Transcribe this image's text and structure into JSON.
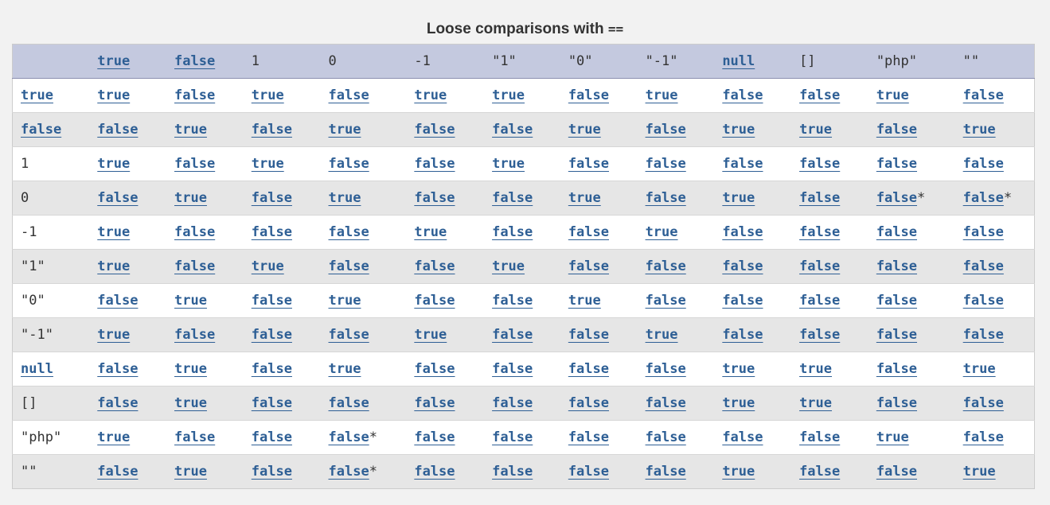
{
  "caption": {
    "text": "Loose comparisons with",
    "operator": "=="
  },
  "columns": [
    "",
    "true",
    "false",
    "1",
    "0",
    "-1",
    "\"1\"",
    "\"0\"",
    "\"-1\"",
    "null",
    "[]",
    "\"php\"",
    "\"\""
  ],
  "rows": [
    {
      "label": "true",
      "cells": [
        "true",
        "false",
        "true",
        "false",
        "true",
        "true",
        "false",
        "true",
        "false",
        "false",
        "true",
        "false"
      ]
    },
    {
      "label": "false",
      "cells": [
        "false",
        "true",
        "false",
        "true",
        "false",
        "false",
        "true",
        "false",
        "true",
        "true",
        "false",
        "true"
      ]
    },
    {
      "label": "1",
      "cells": [
        "true",
        "false",
        "true",
        "false",
        "false",
        "true",
        "false",
        "false",
        "false",
        "false",
        "false",
        "false"
      ]
    },
    {
      "label": "0",
      "cells": [
        "false",
        "true",
        "false",
        "true",
        "false",
        "false",
        "true",
        "false",
        "true",
        "false",
        "false*",
        "false*"
      ]
    },
    {
      "label": "-1",
      "cells": [
        "true",
        "false",
        "false",
        "false",
        "true",
        "false",
        "false",
        "true",
        "false",
        "false",
        "false",
        "false"
      ]
    },
    {
      "label": "\"1\"",
      "cells": [
        "true",
        "false",
        "true",
        "false",
        "false",
        "true",
        "false",
        "false",
        "false",
        "false",
        "false",
        "false"
      ]
    },
    {
      "label": "\"0\"",
      "cells": [
        "false",
        "true",
        "false",
        "true",
        "false",
        "false",
        "true",
        "false",
        "false",
        "false",
        "false",
        "false"
      ]
    },
    {
      "label": "\"-1\"",
      "cells": [
        "true",
        "false",
        "false",
        "false",
        "true",
        "false",
        "false",
        "true",
        "false",
        "false",
        "false",
        "false"
      ]
    },
    {
      "label": "null",
      "cells": [
        "false",
        "true",
        "false",
        "true",
        "false",
        "false",
        "false",
        "false",
        "true",
        "true",
        "false",
        "true"
      ]
    },
    {
      "label": "[]",
      "cells": [
        "false",
        "true",
        "false",
        "false",
        "false",
        "false",
        "false",
        "false",
        "true",
        "true",
        "false",
        "false"
      ]
    },
    {
      "label": "\"php\"",
      "cells": [
        "true",
        "false",
        "false",
        "false*",
        "false",
        "false",
        "false",
        "false",
        "false",
        "false",
        "true",
        "false"
      ]
    },
    {
      "label": "\"\"",
      "cells": [
        "false",
        "true",
        "false",
        "false*",
        "false",
        "false",
        "false",
        "false",
        "true",
        "false",
        "false",
        "true"
      ]
    }
  ]
}
